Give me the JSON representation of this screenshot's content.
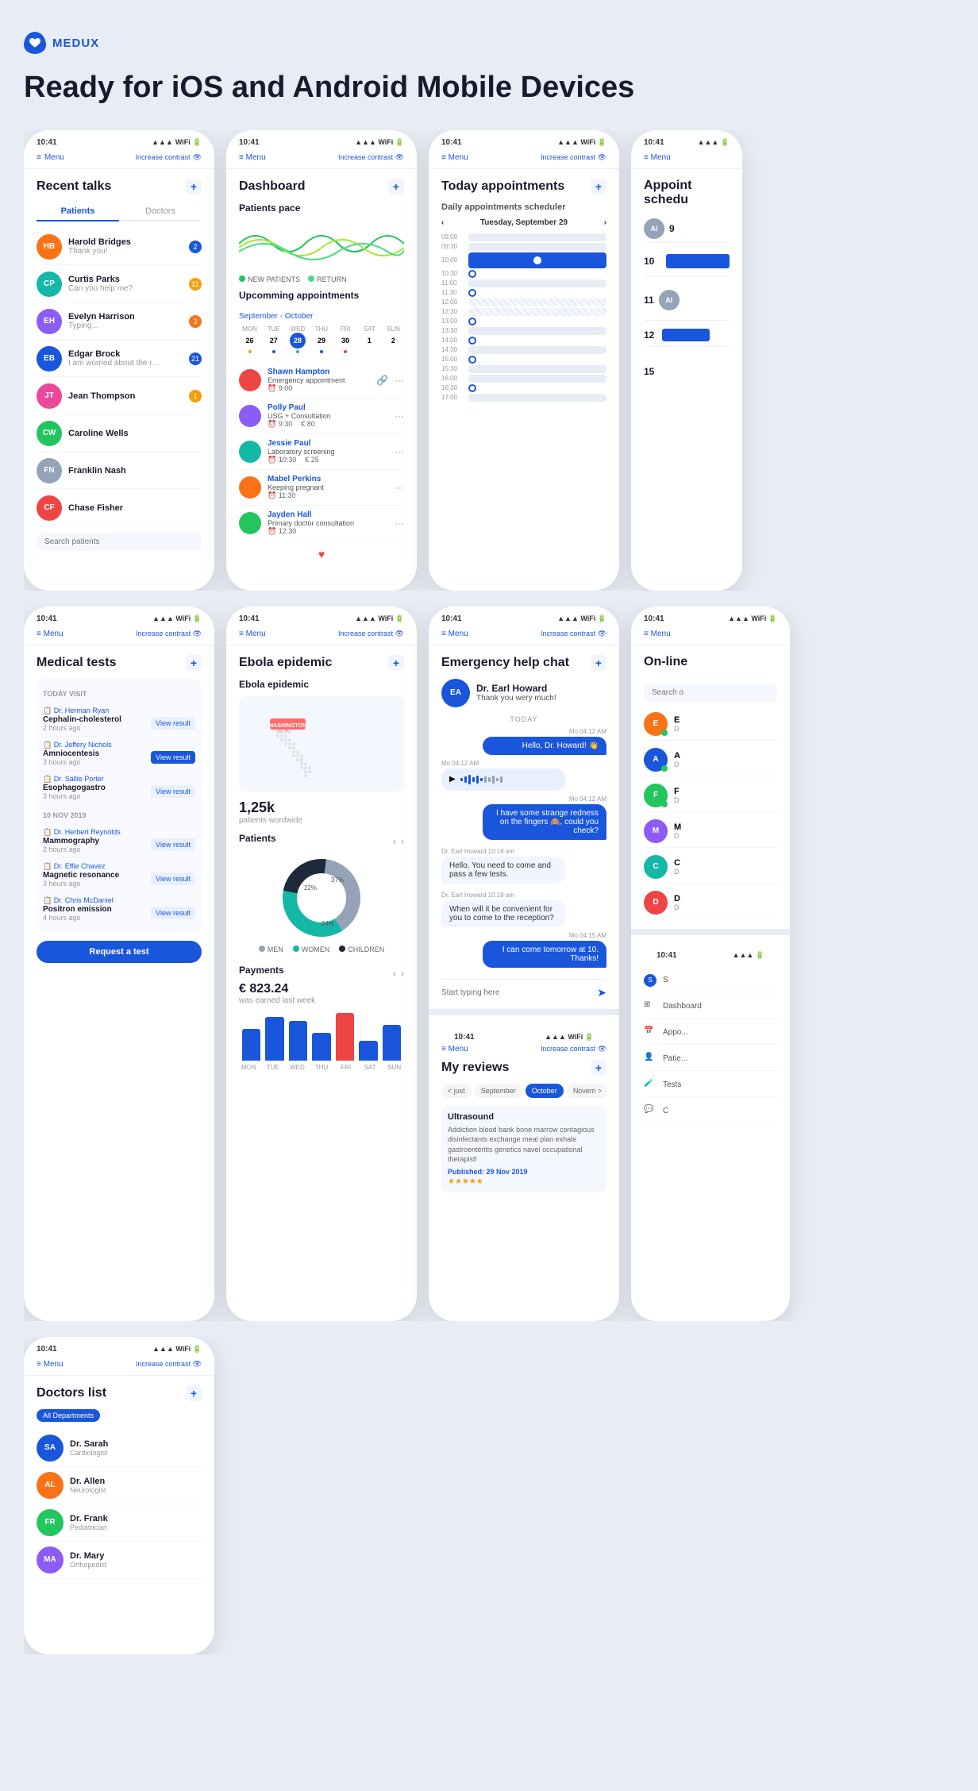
{
  "logo": {
    "text": "MEDUX"
  },
  "hero": {
    "title": "Ready for iOS and Android Mobile Devices"
  },
  "phones": {
    "recent_talks": {
      "status_time": "10:41",
      "nav_menu": "Menu",
      "nav_contrast": "Increase contrast",
      "title": "Recent talks",
      "tab_patients": "Patients",
      "tab_doctors": "Doctors",
      "chats": [
        {
          "name": "Harold Bridges",
          "msg": "Thank you!",
          "badge": "2",
          "badge_type": "blue"
        },
        {
          "name": "Curtis Parks",
          "msg": "Can you help me?",
          "badge": "11",
          "badge_type": "yellow"
        },
        {
          "name": "Evelyn Harrison",
          "msg": "Typing...",
          "badge": "3",
          "badge_type": "orange"
        },
        {
          "name": "Edgar Brock",
          "msg": "I am worried about the resuts...",
          "badge": "21",
          "badge_type": "blue"
        },
        {
          "name": "Jean Thompson",
          "msg": "",
          "badge": "1",
          "badge_type": "yellow"
        },
        {
          "name": "Caroline Wells",
          "msg": "",
          "badge": "",
          "badge_type": ""
        },
        {
          "name": "Franklin Nash",
          "msg": "",
          "badge": "",
          "badge_type": ""
        },
        {
          "name": "Chase Fisher",
          "msg": "",
          "badge": "",
          "badge_type": ""
        }
      ],
      "search_placeholder": "Search patients"
    },
    "dashboard": {
      "status_time": "10:41",
      "title": "Dashboard",
      "patients_pace": "Patients pace",
      "legend_new": "NEW PATIENTS",
      "legend_return": "RETURN",
      "upcoming_title": "Upcomming appointments",
      "upcoming_date": "September - October",
      "week_days": [
        "MON",
        "TUE",
        "WED",
        "THU",
        "FRI",
        "SAT",
        "SUN"
      ],
      "week_nums": [
        "26",
        "27",
        "28",
        "29",
        "30",
        "1",
        "2"
      ],
      "appointments": [
        {
          "name": "Shawn Hampton",
          "type": "Emergency appointment",
          "time": "9:00",
          "price": ""
        },
        {
          "name": "Polly Paul",
          "type": "USG + Consultation",
          "time": "9:30",
          "price": "€ 80"
        },
        {
          "name": "Jessie Paul",
          "type": "Laboratory screening",
          "time": "10:30",
          "price": "€ 25"
        },
        {
          "name": "Mabel Perkins",
          "type": "Keeping pregnant",
          "time": "11:30",
          "price": ""
        },
        {
          "name": "Jayden Hall",
          "type": "Primary doctor consultation",
          "time": "12:30",
          "price": ""
        }
      ]
    },
    "today_appointments": {
      "status_time": "10:41",
      "title": "Today appointments",
      "scheduler_title": "Daily appointments scheduler",
      "cal_date": "Tuesday, September 29",
      "times": [
        "09:00",
        "09:30",
        "10:00",
        "10:30",
        "11:00",
        "11:30",
        "12:00",
        "12:30",
        "13:00",
        "13:30",
        "14:00",
        "14:30",
        "15:00",
        "15:30",
        "16:00",
        "16:30",
        "17:00"
      ]
    },
    "medical_tests": {
      "status_time": "10:41",
      "title": "Medical tests",
      "today_label": "TODAY VISIT",
      "tests_today": [
        {
          "doctor": "Dr. Herman Ryan",
          "name": "Cephalin-cholesterol",
          "time": "2 hours ago",
          "action": "View result",
          "filled": false
        },
        {
          "doctor": "Dr. Jeffery Nichols",
          "name": "Amniocentesis",
          "time": "3 hours ago",
          "action": "View result",
          "filled": true
        },
        {
          "doctor": "Dr. Sallie Porter",
          "name": "Esophagogastro",
          "time": "3 hours ago",
          "action": "View result",
          "filled": false
        }
      ],
      "date_label": "10 NOV 2019",
      "tests_past": [
        {
          "doctor": "Dr. Herbert Reynolds",
          "name": "Mammography",
          "time": "2 hours ago",
          "action": "View result",
          "filled": false
        },
        {
          "doctor": "Dr. Effie Chavez",
          "name": "Magnetic resonance",
          "time": "3 hours ago",
          "action": "View result",
          "filled": false
        },
        {
          "doctor": "Dr. Chris McDaniel",
          "name": "Positron emission",
          "time": "4 hours ago",
          "action": "View result",
          "filled": false
        }
      ],
      "request_btn": "Request a test"
    },
    "emergency_chat": {
      "status_time": "10:41",
      "title": "Emergency help chat",
      "doctor_name": "Dr. Earl Howard",
      "doctor_thanks": "Thank you wery much!",
      "today_label": "TODAY",
      "messages": [
        {
          "type": "sent",
          "text": "Hello, Dr. Howard! 👋",
          "time": "Mo 04:12 AM"
        },
        {
          "type": "received",
          "text": "voice_message",
          "time": "Mo 04:12 AM"
        },
        {
          "type": "sent",
          "text": "I have some strange redness on the fingers 🙈, could you check?",
          "time": "Mo 04:12 AM"
        },
        {
          "type": "received_dr",
          "text": "Hello. You need to come and pass a few tests.",
          "time": "Dr. Earl Howard  10:18 am"
        },
        {
          "type": "received_dr",
          "text": "When will it be convenient for you to come to the reception?",
          "time": "Dr. Earl Howard  10:18 am"
        },
        {
          "type": "sent",
          "text": "I can come tomorrow at 10. Thanks!",
          "time": "Mo 04:15 AM"
        }
      ],
      "input_placeholder": "Start typing here"
    },
    "ebola": {
      "status_time": "10:41",
      "title": "Ebola epidemic",
      "section_title": "Ebola epidemic",
      "map_label": "WASHINGTON",
      "stat_number": "1,25k",
      "stat_label": "patients wordwide",
      "patients_title": "Patients",
      "pie_data": [
        {
          "label": "MEN",
          "value": 22,
          "color": "#94a3b8"
        },
        {
          "label": "WOMEN",
          "value": 37,
          "color": "#14b8a6"
        },
        {
          "label": "CHILDREN",
          "value": 24,
          "color": "#1e293b"
        }
      ]
    },
    "payments": {
      "title": "Payments",
      "amount": "€ 823.24",
      "label": "was earned last week",
      "bars": [
        40,
        55,
        70,
        45,
        80,
        30,
        60
      ],
      "bar_labels": [
        "MON",
        "TUE",
        "WED",
        "THU",
        "FRI",
        "SAT",
        "SUN"
      ],
      "bar_colors": [
        "#1a56db",
        "#1a56db",
        "#1a56db",
        "#1a56db",
        "#ef4444",
        "#1a56db",
        "#1a56db"
      ]
    },
    "reviews": {
      "status_time": "10:41",
      "title": "My reviews",
      "months": [
        "< just",
        "September",
        "October",
        "Novem >"
      ],
      "active_month": "October",
      "review_type": "Ultrasound",
      "review_text": "Addiction blood bank bone marrow contagious disinfectants exchange meal plan exhale gastroenteritis genetics navel occupational therapist!",
      "review_date": "Published: 29 Nov 2019"
    },
    "doctors_list": {
      "status_time": "10:41",
      "title": "Doctors list",
      "dept_tabs": [
        "All Departments"
      ],
      "doctors": [
        {
          "name": "Dr. Sarah",
          "spec": "Cardiologist"
        },
        {
          "name": "Dr. Allen",
          "spec": "Neurologist"
        },
        {
          "name": "Dr. Frank",
          "spec": "Pediatrician"
        },
        {
          "name": "Dr. Mary",
          "spec": "Orthopedist"
        }
      ]
    },
    "online_doctors": {
      "status_time": "10:41",
      "title": "On-line",
      "search_placeholder": "Search o",
      "items": [
        {
          "name": "E",
          "spec": "D",
          "color": "av-blue"
        },
        {
          "name": "A",
          "spec": "D",
          "color": "av-orange"
        },
        {
          "name": "F",
          "spec": "D",
          "color": "av-green"
        },
        {
          "name": "M",
          "spec": "D",
          "color": "av-purple"
        },
        {
          "name": "C",
          "spec": "D",
          "color": "av-pink"
        },
        {
          "name": "D",
          "spec": "D",
          "color": "av-teal"
        }
      ]
    },
    "appoint_sched": {
      "status_time": "10:41",
      "title": "Appoint schedu",
      "numbers": [
        "9",
        "10",
        "11",
        "12",
        "15"
      ]
    },
    "nav_phone": {
      "status_time": "10:41",
      "items": [
        "S",
        "Dashboard",
        "Appo...",
        "Patie...",
        "Tests",
        "C"
      ]
    }
  }
}
